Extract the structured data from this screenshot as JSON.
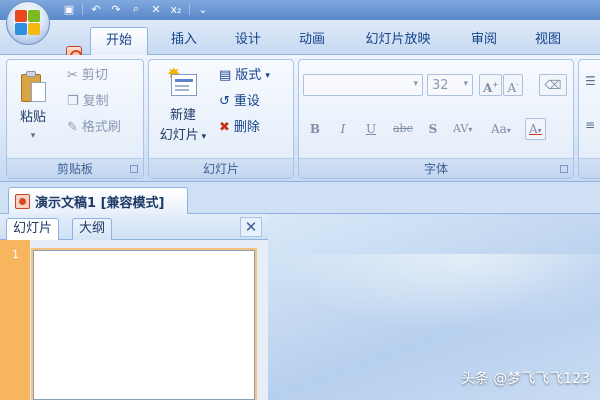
{
  "tabs": [
    "开始",
    "插入",
    "设计",
    "动画",
    "幻灯片放映",
    "审阅",
    "视图"
  ],
  "clipboard": {
    "paste": "粘贴",
    "cut": "剪切",
    "copy": "复制",
    "format_painter": "格式刷",
    "label": "剪贴板"
  },
  "slides_group": {
    "new_slide_line1": "新建",
    "new_slide_line2": "幻灯片",
    "layout": "版式",
    "reset": "重设",
    "delete": "删除",
    "label": "幻灯片"
  },
  "font_group": {
    "font_size": "32",
    "bold": "B",
    "italic": "I",
    "underline": "U",
    "strikethrough": "abc",
    "shadow": "S",
    "spacing": "AV",
    "change_case": "Aa",
    "grow": "A",
    "shrink": "A",
    "color": "A",
    "label": "字体"
  },
  "document_tab": "演示文稿1 [兼容模式]",
  "panel": {
    "tab_slides": "幻灯片",
    "tab_outline": "大纲",
    "close": "✕",
    "slide_number": "1"
  },
  "watermark": "头条 @梦飞飞飞123",
  "colors": {
    "ribbon_blue": "#15428b",
    "slide_bar_orange": "#f7b55e"
  },
  "icons": [
    "office-logo",
    "save-icon",
    "undo-icon",
    "redo-icon",
    "print-preview-icon",
    "powerpoint-icon",
    "paste-icon",
    "cut-icon",
    "copy-icon",
    "format-painter-icon",
    "new-slide-icon",
    "layout-icon",
    "reset-icon",
    "delete-icon",
    "dialog-launcher-icon",
    "close-icon"
  ]
}
